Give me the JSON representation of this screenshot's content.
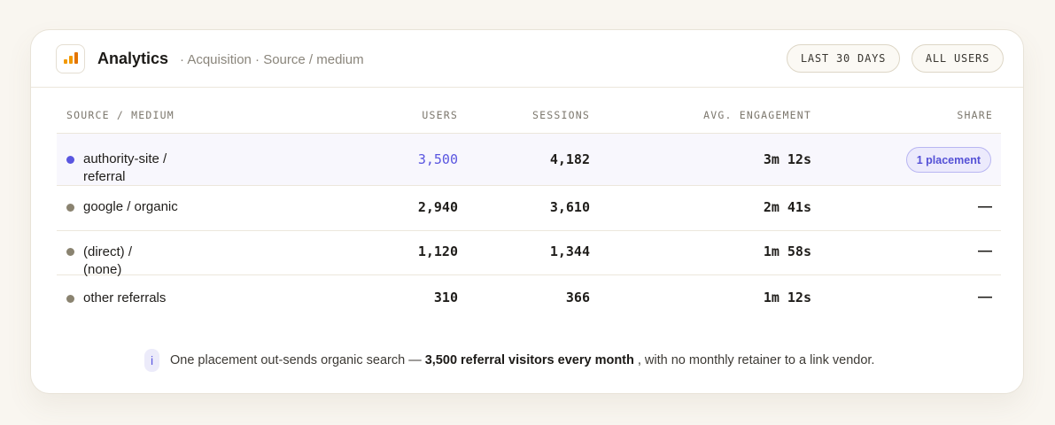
{
  "header": {
    "title": "Analytics",
    "breadcrumb": "· Acquisition · Source / medium",
    "filter_range": "LAST 30 DAYS",
    "filter_users": "ALL USERS"
  },
  "table": {
    "columns": [
      "SOURCE / MEDIUM",
      "USERS",
      "SESSIONS",
      "AVG. ENGAGEMENT",
      "SHARE"
    ],
    "rows": [
      {
        "source_line1": "authority-site /",
        "source_line2": "referral",
        "users": "3,500",
        "sessions": "4,182",
        "engagement": "3m 12s",
        "share": "1 placement",
        "dot_color": "#5a56e0"
      },
      {
        "source_line1": "google / organic",
        "source_line2": "",
        "users": "2,940",
        "sessions": "3,610",
        "engagement": "2m 41s",
        "share": "—",
        "dot_color": "#8a8370"
      },
      {
        "source_line1": "(direct) /",
        "source_line2": "(none)",
        "users": "1,120",
        "sessions": "1,344",
        "engagement": "1m 58s",
        "share": "—",
        "dot_color": "#8a8370"
      },
      {
        "source_line1": "other referrals",
        "source_line2": "",
        "users": "310",
        "sessions": "366",
        "engagement": "1m 12s",
        "share": "—",
        "dot_color": "#8a8370"
      }
    ]
  },
  "footer": {
    "info_glyph": "i",
    "text_before": "One placement out-sends organic search —",
    "text_bold": "3,500 referral visitors every month",
    "text_after": ", with no monthly retainer to a link vendor."
  },
  "colors": {
    "accent": "#5a56e0",
    "muted_dot": "#8a8370"
  }
}
